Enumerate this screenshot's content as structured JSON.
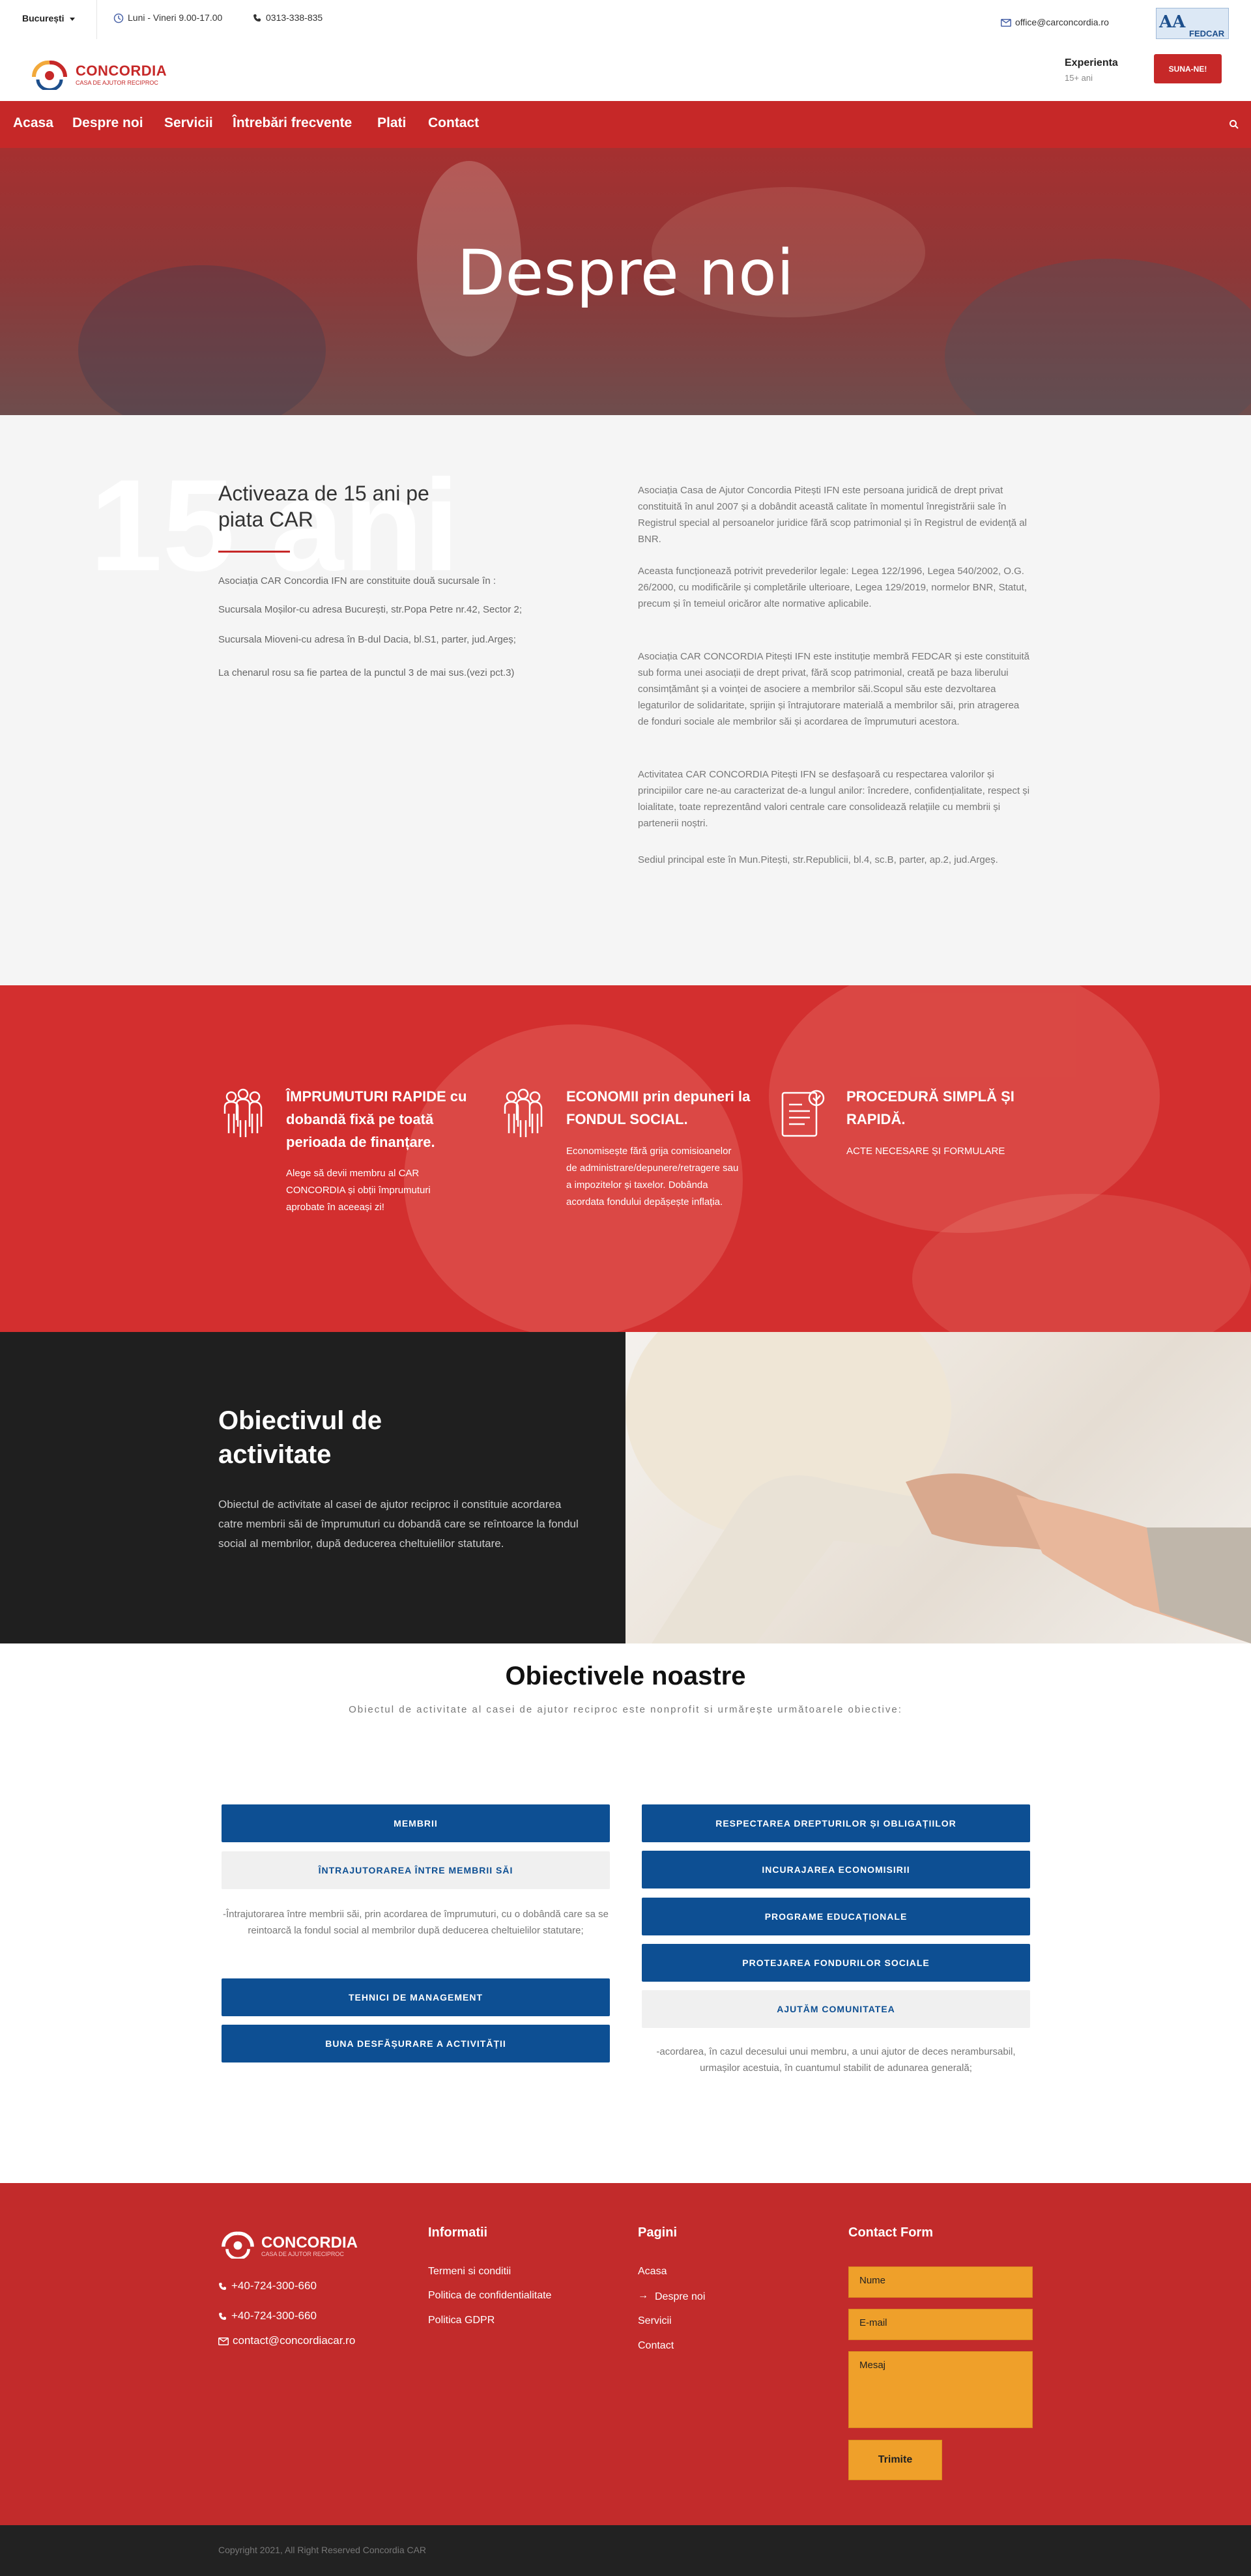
{
  "topbar": {
    "city": "București",
    "hours": "Luni - Vineri 9.00-17.00",
    "phone": "0313-338-835",
    "email": "office@carconcordia.ro",
    "badge_text": "FEDCAR"
  },
  "header": {
    "logo_name": "CONCORDIA",
    "logo_tagline": "CASA DE AJUTOR RECIPROC",
    "experience_title": "Experienta",
    "experience_sub": "15+ ani",
    "cta": "SUNA-NE!"
  },
  "nav": {
    "items": [
      "Acasa",
      "Despre noi",
      "Servicii",
      "Întrebări frecvente",
      "Plati",
      "Contact"
    ]
  },
  "hero": {
    "title": "Despre noi"
  },
  "about": {
    "big_number": "15 ani",
    "heading": "Activeaza de 15 ani pe piata CAR",
    "left_paragraphs": [
      "Asociația CAR Concordia IFN are constituite două sucursale în :",
      "Sucursala Moșilor-cu adresa București, str.Popa Petre nr.42, Sector 2;",
      "Sucursala Mioveni-cu adresa în B-dul Dacia, bl.S1, parter, jud.Argeș;",
      "La chenarul rosu sa fie partea de la punctul 3 de mai sus.(vezi pct.3)"
    ],
    "right_paragraphs": [
      "Asociația Casa de Ajutor Concordia Pitești IFN este persoana juridică de drept privat constituită în anul 2007 și a dobândit această calitate în momentul înregistrării sale în Registrul special al persoanelor juridice fără scop patrimonial și în Registrul de evidență al BNR.",
      "Aceasta funcționează potrivit prevederilor legale: Legea 122/1996, Legea 540/2002, O.G. 26/2000, cu modificările și completările ulterioare, Legea 129/2019, normelor BNR, Statut, precum și în temeiul oricăror alte normative aplicabile.",
      "Asociația CAR CONCORDIA Pitești IFN este instituție membră FEDCAR și este constituită sub forma unei asociații de drept privat, fără scop patrimonial, creată pe baza liberului consimțământ și a voinței de asociere a membrilor săi.Scopul său este dezvoltarea legaturilor de solidaritate, sprijin și întrajutorare materială a membrilor săi, prin atragerea de fonduri sociale ale membrilor săi și acordarea de împrumuturi acestora.",
      "Activitatea CAR CONCORDIA Pitești IFN se desfașoară cu respectarea valorilor și principiilor care ne-au caracterizat de-a lungul anilor: încredere, confidențialitate, respect și loialitate, toate reprezentând valori centrale care consolidează relațiile cu membrii și partenerii noștri.",
      "Sediul principal este în Mun.Pitești, str.Republicii, bl.4, sc.B, parter, ap.2, jud.Argeș."
    ]
  },
  "features": [
    {
      "title": "ÎMPRUMUTURI RAPIDE cu dobandă fixă pe toată perioada de finanțare.",
      "text": "Alege să devii membru al CAR CONCORDIA și obții împrumuturi aprobate în aceeași zi!"
    },
    {
      "title": "ECONOMII prin depuneri la FONDUL SOCIAL.",
      "text": "Economisește fără grija comisioanelor de administrare/depunere/retragere sau a impozitelor și taxelor. Dobânda acordata fondului depășește inflația."
    },
    {
      "title": "PROCEDURĂ SIMPLĂ ȘI RAPIDĂ.",
      "text": "ACTE NECESARE ȘI FORMULARE"
    }
  ],
  "objective": {
    "title": "Obiectivul de activitate",
    "text": "Obiectul de activitate al casei de ajutor reciproc il constituie acordarea catre membrii săi de împrumuturi cu dobandă care se reîntoarce la fondul social al membrilor, după deducerea cheltuielilor statutare."
  },
  "goals": {
    "title": "Obiectivele noastre",
    "subtitle": "Obiectul de activitate al casei de ajutor reciproc este nonprofit si urmărește următoarele obiective:",
    "left": {
      "tab1": "MEMBRII",
      "tab2": "ÎNTRAJUTORAREA ÎNTRE MEMBRII SĂI",
      "text": "-Întrajutorarea între membrii săi, prin acordarea de împrumuturi, cu o dobândă care sa se reintoarcă la fondul social al membrilor după deducerea cheltuielilor statutare;",
      "tab3": "TEHNICI DE MANAGEMENT",
      "tab4": "BUNA DESFĂȘURARE A ACTIVITĂȚII"
    },
    "right": {
      "tab1": "RESPECTAREA DREPTURILOR ȘI OBLIGAȚIILOR",
      "tab2": "INCURAJAREA ECONOMISIRII",
      "tab3": "PROGRAME EDUCAȚIONALE",
      "tab4": "PROTEJAREA FONDURILOR SOCIALE",
      "tab5": "AJUTĂM COMUNITATEA",
      "text": "-acordarea, în cazul decesului unui membru, a unui ajutor de deces nerambursabil, urmașilor acestuia, în cuantumul stabilit de adunarea generală;"
    }
  },
  "footer": {
    "logo_name": "CONCORDIA",
    "logo_tagline": "CASA DE AJUTOR RECIPROC",
    "phone1": "+40-724-300-660",
    "phone2": "+40-724-300-660",
    "email": "contact@concordiacar.ro",
    "info_title": "Informatii",
    "info_links": [
      "Termeni si conditii",
      "Politica de confidentialitate",
      "Politica GDPR"
    ],
    "pages_title": "Pagini",
    "pages_links": [
      "Acasa",
      "Despre noi",
      "Servicii",
      "Contact"
    ],
    "form_title": "Contact Form",
    "form_name": "Nume",
    "form_email": "E-mail",
    "form_message": "Mesaj",
    "form_submit": "Trimite"
  },
  "copyright": "Copyright 2021, All Right Reserved Concordia CAR",
  "colors": {
    "brand_red": "#c62828",
    "blue": "#0d4f93",
    "orange": "#efa02a",
    "dark": "#1f1f1f"
  }
}
